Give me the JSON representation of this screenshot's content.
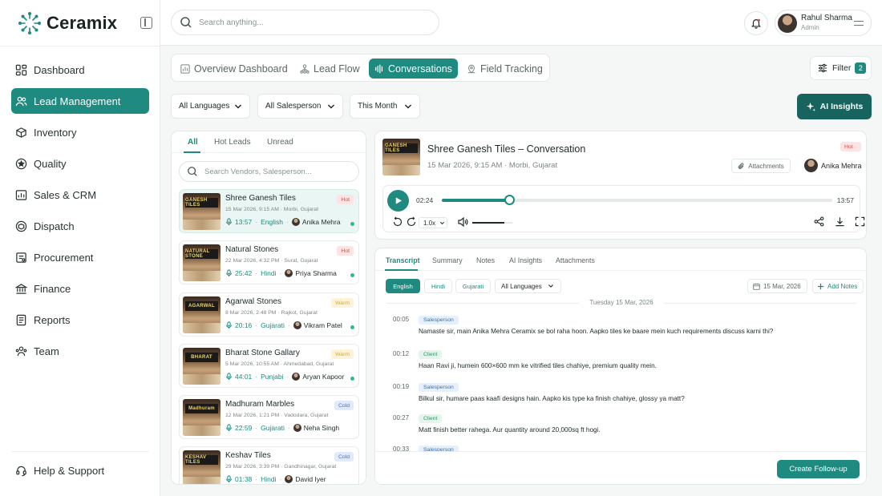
{
  "app": {
    "name": "Ceramix"
  },
  "sidebar": {
    "items": [
      {
        "label": "Dashboard"
      },
      {
        "label": "Lead Management"
      },
      {
        "label": "Inventory"
      },
      {
        "label": "Quality"
      },
      {
        "label": "Sales & CRM"
      },
      {
        "label": "Dispatch"
      },
      {
        "label": "Procurement"
      },
      {
        "label": "Finance"
      },
      {
        "label": "Reports"
      },
      {
        "label": "Team"
      }
    ],
    "help": "Help & Support"
  },
  "topbar": {
    "search_placeholder": "Search anything...",
    "user_name": "Rahul Sharma",
    "user_role": "Admin"
  },
  "tabs": [
    "Overview Dashboard",
    "Lead Flow",
    "Conversations",
    "Field Tracking"
  ],
  "filter": {
    "label": "Filter",
    "count": "2"
  },
  "dropdowns": [
    "All Languages",
    "All Salesperson",
    "This Month"
  ],
  "ai_insights": "AI Insights",
  "list": {
    "tabs": [
      "All",
      "Hot Leads",
      "Unread"
    ],
    "search_placeholder": "Search Vendors, Salesperson...",
    "items": [
      {
        "name": "Shree Ganesh Tiles",
        "tag": "Hot",
        "meta": "15 Mar 2026, 9:15 AM · Morbi, Gujarat",
        "duration": "13:57",
        "lang": "English",
        "person": "Anika Mehra",
        "sign": "GANESH TILES"
      },
      {
        "name": "Natural Stones",
        "tag": "Hot",
        "meta": "22 Mar 2026, 4:32 PM · Surat, Gujarat",
        "duration": "25:42",
        "lang": "Hindi",
        "person": "Priya Sharma",
        "sign": "NATURAL STONE"
      },
      {
        "name": "Agarwal Stones",
        "tag": "Warm",
        "meta": "8 Mar 2026, 2:48 PM · Rajkot, Gujarat",
        "duration": "20:16",
        "lang": "Gujarati",
        "person": "Vikram Patel",
        "sign": "AGARWAL"
      },
      {
        "name": "Bharat Stone Gallary",
        "tag": "Warm",
        "meta": "5 Mar 2026, 10:55 AM · Ahmedabad, Gujarat",
        "duration": "44:01",
        "lang": "Punjabi",
        "person": "Aryan Kapoor",
        "sign": "BHARAT"
      },
      {
        "name": "Madhuram Marbles",
        "tag": "Cold",
        "meta": "12 Mar 2026, 1:21 PM · Vadodara, Gujarat",
        "duration": "22:59",
        "lang": "Gujarati",
        "person": "Neha Singh",
        "sign": "Madhuram"
      },
      {
        "name": "Keshav Tiles",
        "tag": "Cold",
        "meta": "29 Mar 2026, 3:39 PM · Gandhinagar, Gujarat",
        "duration": "01:38",
        "lang": "Hindi",
        "person": "David Iyer",
        "sign": "KESHAV TILES"
      }
    ]
  },
  "player": {
    "title": "Shree Ganesh Tiles – Conversation",
    "meta": "15 Mar 2026, 9:15 AM · Morbi, Gujarat",
    "tag": "Hot",
    "attachments": "Attachments",
    "person": "Anika Mehra",
    "current": "02:24",
    "total": "13:57",
    "progress": 0.172,
    "speed": "1.0x",
    "volume": 0.8,
    "sign": "GANESH TILES"
  },
  "transcript": {
    "tabs": [
      "Transcript",
      "Summary",
      "Notes",
      "AI Insights",
      "Attachments"
    ],
    "langs": [
      "English",
      "Hindi",
      "Gujarati"
    ],
    "lang_dropdown": "All Languages",
    "date": "15 Mar, 2026",
    "add_notes": "Add Notes",
    "day": "Tuesday 15 Mar, 2026",
    "messages": [
      {
        "time": "00:05",
        "role": "Salesperson",
        "text": "Namaste sir, main Anika Mehra Ceramix se bol raha hoon. Aapko tiles ke baare mein kuch requirements discuss karni thi?"
      },
      {
        "time": "00:12",
        "role": "Client",
        "text": "Haan Ravi ji, humein 600×600 mm ke vitrified tiles chahiye, premium quality mein."
      },
      {
        "time": "00:19",
        "role": "Salesperson",
        "text": "Bilkul sir, humare paas kaafi designs hain. Aapko kis type ka finish chahiye, glossy ya matt?"
      },
      {
        "time": "00:27",
        "role": "Client",
        "text": "Matt finish better rahega. Aur quantity around 20,000sq ft hogi."
      },
      {
        "time": "00:33",
        "role": "Salesperson",
        "text": ""
      }
    ],
    "follow_up": "Create Follow-up"
  },
  "colors": {
    "accent": "#1e8a80",
    "accent_dark": "#17645e",
    "hot": "#d14b4b",
    "warm": "#d6a62b",
    "cold": "#4b6fcf"
  }
}
